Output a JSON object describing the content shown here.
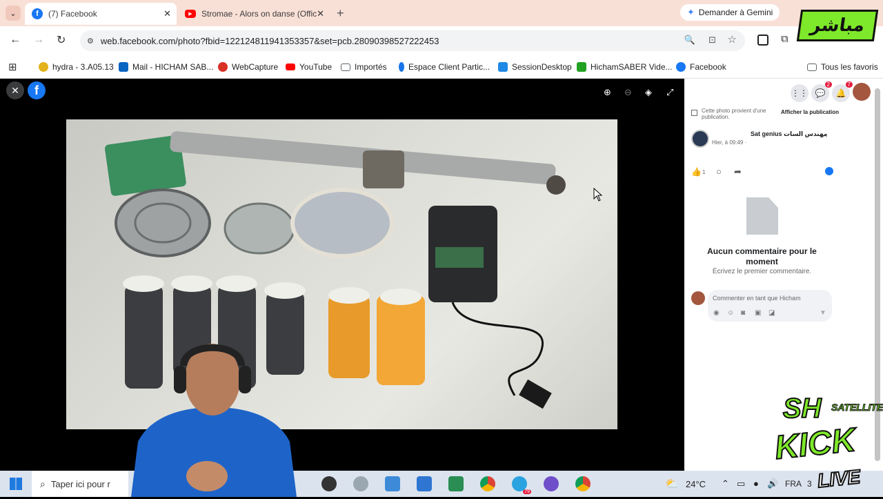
{
  "tabs": [
    {
      "title": "(7) Facebook",
      "icon": "facebook-icon",
      "active": true
    },
    {
      "title": "Stromae - Alors on danse (Offic",
      "icon": "youtube-icon",
      "active": false
    }
  ],
  "gemini_button": "Demander à Gemini",
  "overlay_live_badge": "مباشر",
  "url": "web.facebook.com/photo?fbid=122124811941353357&set=pcb.28090398527222453",
  "bookmarks": [
    {
      "label": "hydra - 3.A05.13",
      "icon": "hydra-icon",
      "color": "#e3b21c"
    },
    {
      "label": "Mail - HICHAM SAB...",
      "icon": "outlook-icon",
      "color": "#0a64c2"
    },
    {
      "label": "WebCapture",
      "icon": "webcapture-icon",
      "color": "#d93025"
    },
    {
      "label": "YouTube",
      "icon": "youtube-icon",
      "color": "#ff0000"
    },
    {
      "label": "Importés",
      "icon": "folder-icon",
      "color": "#5f6368"
    },
    {
      "label": "Espace Client Partic...",
      "icon": "bank-icon",
      "color": "#1a73e8"
    },
    {
      "label": "SessionDesktop",
      "icon": "session-icon",
      "color": "#1e88e5"
    },
    {
      "label": "HichamSABER Vide...",
      "icon": "kick-icon",
      "color": "#21a121"
    },
    {
      "label": "Facebook",
      "icon": "facebook-icon",
      "color": "#1877f2"
    }
  ],
  "all_favorites": "Tous les favoris",
  "side": {
    "notice": "Cette photo provient d'une publication.",
    "show_post": "Afficher la publication",
    "author": "Sat genius مهندس السات",
    "time": "Hier, à 09:49 · ",
    "like_count": "1",
    "no_comments_title": "Aucun commentaire pour le moment",
    "no_comments_sub": "Écrivez le premier commentaire.",
    "comment_placeholder": "Commenter en tant que Hicham",
    "notif_messenger": "2",
    "notif_bell": "7"
  },
  "taskbar": {
    "search_placeholder": "Taper ici pour r",
    "weather": "24°C",
    "lang": "FRA",
    "badge": "79",
    "time_partial": "3"
  },
  "overlay": {
    "brand_sh": "SH",
    "brand_satellite": "SATELLITE",
    "brand_kick": "KICK",
    "brand_live": "LIVE"
  },
  "colors": {
    "facebook": "#1877f2",
    "accent_green": "#7ee82a",
    "tab_bg": "#f9e0d7"
  }
}
